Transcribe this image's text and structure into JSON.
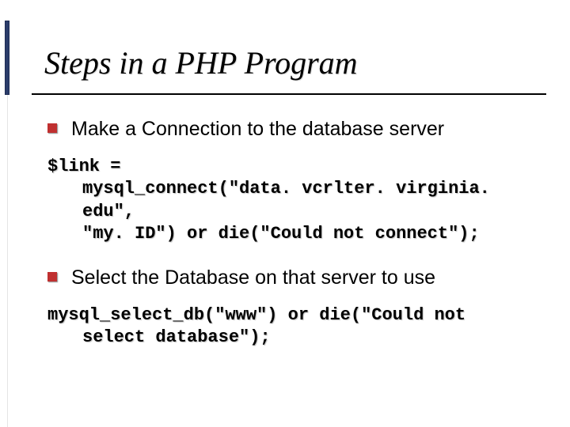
{
  "title": "Steps in a PHP Program",
  "bullets": [
    {
      "text": "Make a Connection to the database server"
    },
    {
      "text": "Select the Database on that server to use"
    }
  ],
  "code": [
    {
      "line1": "$link =",
      "line2": "mysql_connect(\"data. vcrlter. virginia. edu\",",
      "line3": "\"my. ID\") or die(\"Could not connect\");"
    },
    {
      "line1": "mysql_select_db(\"www\") or die(\"Could not",
      "line2": "select database\");"
    }
  ]
}
